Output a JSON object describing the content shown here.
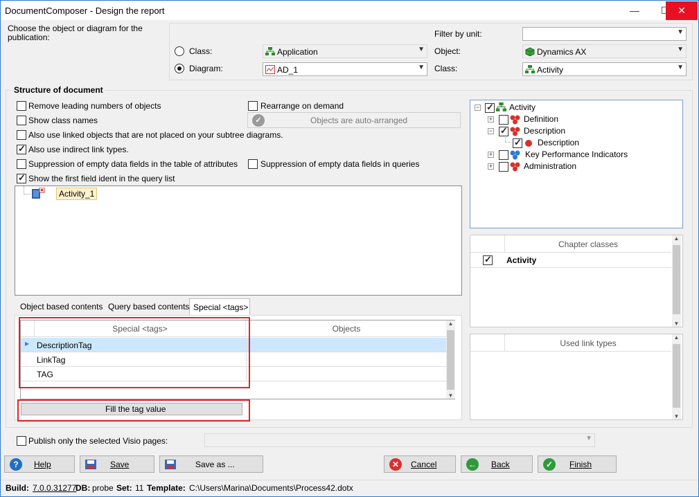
{
  "window": {
    "title": "DocumentComposer - Design the report"
  },
  "selection": {
    "prompt": "Choose the object or diagram for the publication:",
    "class_radio_label": "Class:",
    "class_value": "Application",
    "diagram_radio_label": "Diagram:",
    "diagram_value": "AD_1",
    "filter_label": "Filter by unit:",
    "filter_value": "",
    "object_label": "Object:",
    "object_value": "Dynamics AX",
    "class2_label": "Class:",
    "class2_value": "Activity"
  },
  "structure": {
    "title": "Structure of document",
    "options": [
      {
        "label": "Remove leading numbers of objects",
        "checked": false
      },
      {
        "label": "Show class names",
        "checked": false
      },
      {
        "label": "Also use linked objects that are not placed on your subtree diagrams.",
        "checked": false
      },
      {
        "label": "Also use indirect link types.",
        "checked": true
      },
      {
        "label": "Suppression of empty data fields in the table of attributes",
        "checked": false
      },
      {
        "label": "Show the first field ident in the query list",
        "checked": true
      }
    ],
    "rearrange_label": "Rearrange on demand",
    "auto_arranged_label": "Objects are auto-arranged",
    "suppress_queries_label": "Suppression of empty data fields in queries",
    "tree_node": "Activity_1"
  },
  "tabs": [
    "Object based contents",
    "Query based contents",
    "Special <tags>"
  ],
  "active_tab": 2,
  "tags_table": {
    "headers": [
      "Special <tags>",
      "Objects"
    ],
    "rows": [
      {
        "tag": "DescriptionTag",
        "objects": ""
      },
      {
        "tag": "LinkTag",
        "objects": ""
      },
      {
        "tag": "TAG",
        "objects": ""
      }
    ],
    "fill_button": "Fill the tag value"
  },
  "class_tree": [
    {
      "label": "Activity",
      "level": 0,
      "checked": true
    },
    {
      "label": "Definition",
      "level": 1,
      "checked": false
    },
    {
      "label": "Description",
      "level": 1,
      "checked": true
    },
    {
      "label": "Description",
      "level": 2,
      "checked": true
    },
    {
      "label": "Key Performance Indicators",
      "level": 1,
      "checked": false
    },
    {
      "label": "Administration",
      "level": 1,
      "checked": false
    }
  ],
  "chapter_classes": {
    "header": "Chapter classes",
    "rows": [
      {
        "label": "Activity",
        "checked": true
      }
    ]
  },
  "used_link_types": {
    "header": "Used link types"
  },
  "publish_label": "Publish only the selected Visio pages:",
  "buttons": {
    "help": "Help",
    "save": "Save",
    "save_as": "Save as ...",
    "cancel": "Cancel",
    "back": "Back",
    "finish": "Finish"
  },
  "status": {
    "build_label": "Build:",
    "build_value": "7.0.0.31277",
    "db_label": "DB:",
    "db_value": "probe",
    "set_label": "Set:",
    "set_value": "11",
    "template_label": "Template:",
    "template_value": "C:\\Users\\Marina\\Documents\\Process42.dotx"
  },
  "colors": {
    "accent": "#2b79d0",
    "highlight": "#cce8ff",
    "red_box": "#e0242f",
    "close": "#e81123"
  }
}
